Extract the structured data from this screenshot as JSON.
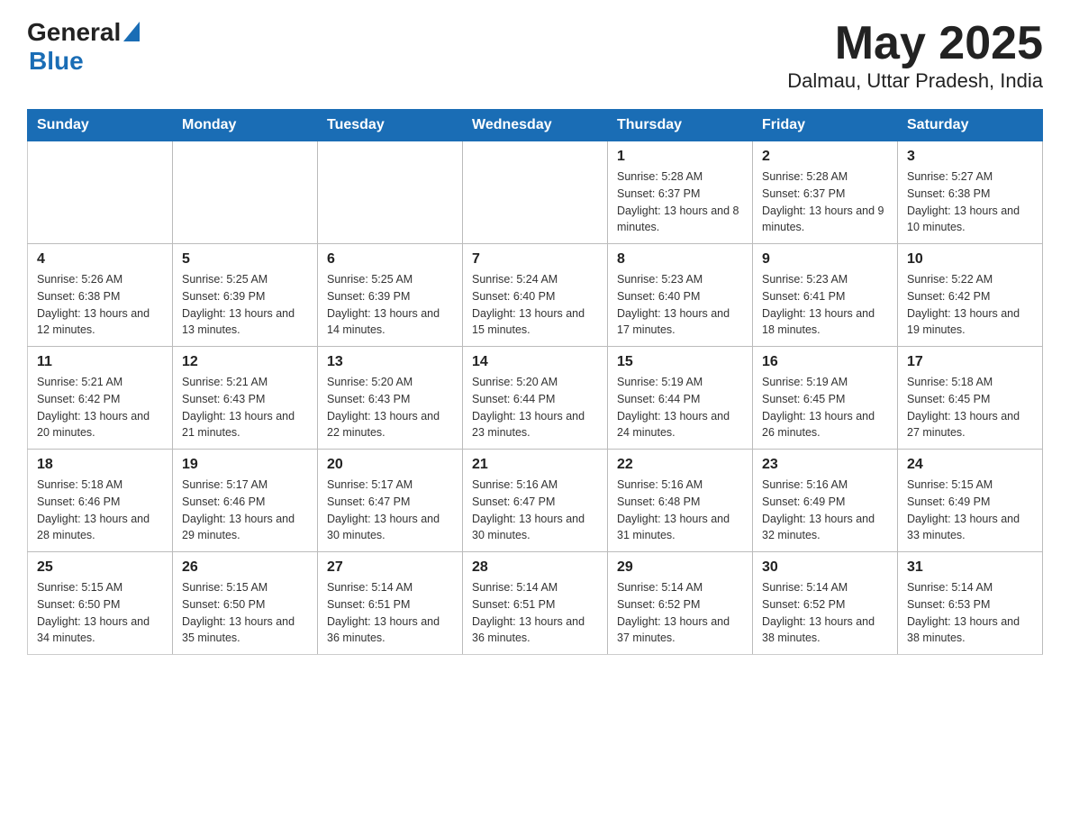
{
  "header": {
    "logo_general": "General",
    "logo_blue": "Blue",
    "title": "May 2025",
    "subtitle": "Dalmau, Uttar Pradesh, India"
  },
  "calendar": {
    "days_of_week": [
      "Sunday",
      "Monday",
      "Tuesday",
      "Wednesday",
      "Thursday",
      "Friday",
      "Saturday"
    ],
    "weeks": [
      [
        {
          "day": "",
          "info": ""
        },
        {
          "day": "",
          "info": ""
        },
        {
          "day": "",
          "info": ""
        },
        {
          "day": "",
          "info": ""
        },
        {
          "day": "1",
          "info": "Sunrise: 5:28 AM\nSunset: 6:37 PM\nDaylight: 13 hours and 8 minutes."
        },
        {
          "day": "2",
          "info": "Sunrise: 5:28 AM\nSunset: 6:37 PM\nDaylight: 13 hours and 9 minutes."
        },
        {
          "day": "3",
          "info": "Sunrise: 5:27 AM\nSunset: 6:38 PM\nDaylight: 13 hours and 10 minutes."
        }
      ],
      [
        {
          "day": "4",
          "info": "Sunrise: 5:26 AM\nSunset: 6:38 PM\nDaylight: 13 hours and 12 minutes."
        },
        {
          "day": "5",
          "info": "Sunrise: 5:25 AM\nSunset: 6:39 PM\nDaylight: 13 hours and 13 minutes."
        },
        {
          "day": "6",
          "info": "Sunrise: 5:25 AM\nSunset: 6:39 PM\nDaylight: 13 hours and 14 minutes."
        },
        {
          "day": "7",
          "info": "Sunrise: 5:24 AM\nSunset: 6:40 PM\nDaylight: 13 hours and 15 minutes."
        },
        {
          "day": "8",
          "info": "Sunrise: 5:23 AM\nSunset: 6:40 PM\nDaylight: 13 hours and 17 minutes."
        },
        {
          "day": "9",
          "info": "Sunrise: 5:23 AM\nSunset: 6:41 PM\nDaylight: 13 hours and 18 minutes."
        },
        {
          "day": "10",
          "info": "Sunrise: 5:22 AM\nSunset: 6:42 PM\nDaylight: 13 hours and 19 minutes."
        }
      ],
      [
        {
          "day": "11",
          "info": "Sunrise: 5:21 AM\nSunset: 6:42 PM\nDaylight: 13 hours and 20 minutes."
        },
        {
          "day": "12",
          "info": "Sunrise: 5:21 AM\nSunset: 6:43 PM\nDaylight: 13 hours and 21 minutes."
        },
        {
          "day": "13",
          "info": "Sunrise: 5:20 AM\nSunset: 6:43 PM\nDaylight: 13 hours and 22 minutes."
        },
        {
          "day": "14",
          "info": "Sunrise: 5:20 AM\nSunset: 6:44 PM\nDaylight: 13 hours and 23 minutes."
        },
        {
          "day": "15",
          "info": "Sunrise: 5:19 AM\nSunset: 6:44 PM\nDaylight: 13 hours and 24 minutes."
        },
        {
          "day": "16",
          "info": "Sunrise: 5:19 AM\nSunset: 6:45 PM\nDaylight: 13 hours and 26 minutes."
        },
        {
          "day": "17",
          "info": "Sunrise: 5:18 AM\nSunset: 6:45 PM\nDaylight: 13 hours and 27 minutes."
        }
      ],
      [
        {
          "day": "18",
          "info": "Sunrise: 5:18 AM\nSunset: 6:46 PM\nDaylight: 13 hours and 28 minutes."
        },
        {
          "day": "19",
          "info": "Sunrise: 5:17 AM\nSunset: 6:46 PM\nDaylight: 13 hours and 29 minutes."
        },
        {
          "day": "20",
          "info": "Sunrise: 5:17 AM\nSunset: 6:47 PM\nDaylight: 13 hours and 30 minutes."
        },
        {
          "day": "21",
          "info": "Sunrise: 5:16 AM\nSunset: 6:47 PM\nDaylight: 13 hours and 30 minutes."
        },
        {
          "day": "22",
          "info": "Sunrise: 5:16 AM\nSunset: 6:48 PM\nDaylight: 13 hours and 31 minutes."
        },
        {
          "day": "23",
          "info": "Sunrise: 5:16 AM\nSunset: 6:49 PM\nDaylight: 13 hours and 32 minutes."
        },
        {
          "day": "24",
          "info": "Sunrise: 5:15 AM\nSunset: 6:49 PM\nDaylight: 13 hours and 33 minutes."
        }
      ],
      [
        {
          "day": "25",
          "info": "Sunrise: 5:15 AM\nSunset: 6:50 PM\nDaylight: 13 hours and 34 minutes."
        },
        {
          "day": "26",
          "info": "Sunrise: 5:15 AM\nSunset: 6:50 PM\nDaylight: 13 hours and 35 minutes."
        },
        {
          "day": "27",
          "info": "Sunrise: 5:14 AM\nSunset: 6:51 PM\nDaylight: 13 hours and 36 minutes."
        },
        {
          "day": "28",
          "info": "Sunrise: 5:14 AM\nSunset: 6:51 PM\nDaylight: 13 hours and 36 minutes."
        },
        {
          "day": "29",
          "info": "Sunrise: 5:14 AM\nSunset: 6:52 PM\nDaylight: 13 hours and 37 minutes."
        },
        {
          "day": "30",
          "info": "Sunrise: 5:14 AM\nSunset: 6:52 PM\nDaylight: 13 hours and 38 minutes."
        },
        {
          "day": "31",
          "info": "Sunrise: 5:14 AM\nSunset: 6:53 PM\nDaylight: 13 hours and 38 minutes."
        }
      ]
    ]
  }
}
